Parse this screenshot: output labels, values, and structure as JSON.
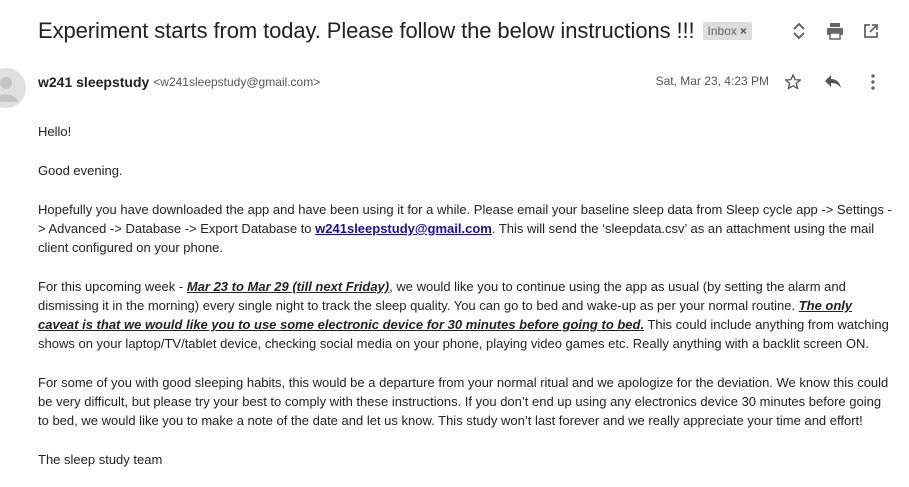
{
  "subject": "Experiment starts from today. Please follow the below instructions !!!",
  "label": {
    "text": "Inbox",
    "close": "×"
  },
  "sender": {
    "name": "w241 sleepstudy",
    "email": "<w241sleepstudy@gmail.com>"
  },
  "date": "Sat, Mar 23, 4:23 PM",
  "icons": {
    "expand": "expand-collapse-icon",
    "print": "print-icon",
    "new_window": "open-in-new-window-icon",
    "star": "star-icon",
    "reply": "reply-icon",
    "more": "more-vert-icon",
    "avatar": "avatar-icon"
  },
  "body": {
    "greeting": "Hello!",
    "evening": "Good evening.",
    "p1_a": "Hopefully you have downloaded the app and have been using it for a while. Please email your baseline sleep data from Sleep cycle app -> Settings -> Advanced -> Database  -> Export Database to ",
    "p1_link": "w241sleepstudy@gmail.com",
    "p1_b": ". This will send the ‘sleepdata.csv’ as an attachment using the mail client configured on your phone.",
    "p2_a": "For this upcoming week - ",
    "p2_dates": "Mar 23 to Mar 29 (till next Friday)",
    "p2_b": ", we would like you to continue using the app as usual (by setting the alarm and dismissing it in the morning) every single night to track the sleep quality.  You can go to bed and wake-up as per your normal routine. ",
    "p2_caveat": "The only caveat is that we would like you to use some electronic device for 30 minutes before going to bed.",
    "p2_c": " This could include anything from watching shows on your laptop/TV/tablet device, checking social media on your phone, playing video games etc. Really anything with a backlit screen ON.",
    "p3": "For some of you with good sleeping habits, this would be a departure from your normal ritual and we apologize for the deviation. We know this could be very difficult, but please try your best to comply with these instructions. If you don’t end up using any electronics device 30 minutes before going to bed, we would like you to make a note of the date and let us know.  This study won’t last forever and we really appreciate your time and effort!",
    "signature": "The sleep study team"
  }
}
